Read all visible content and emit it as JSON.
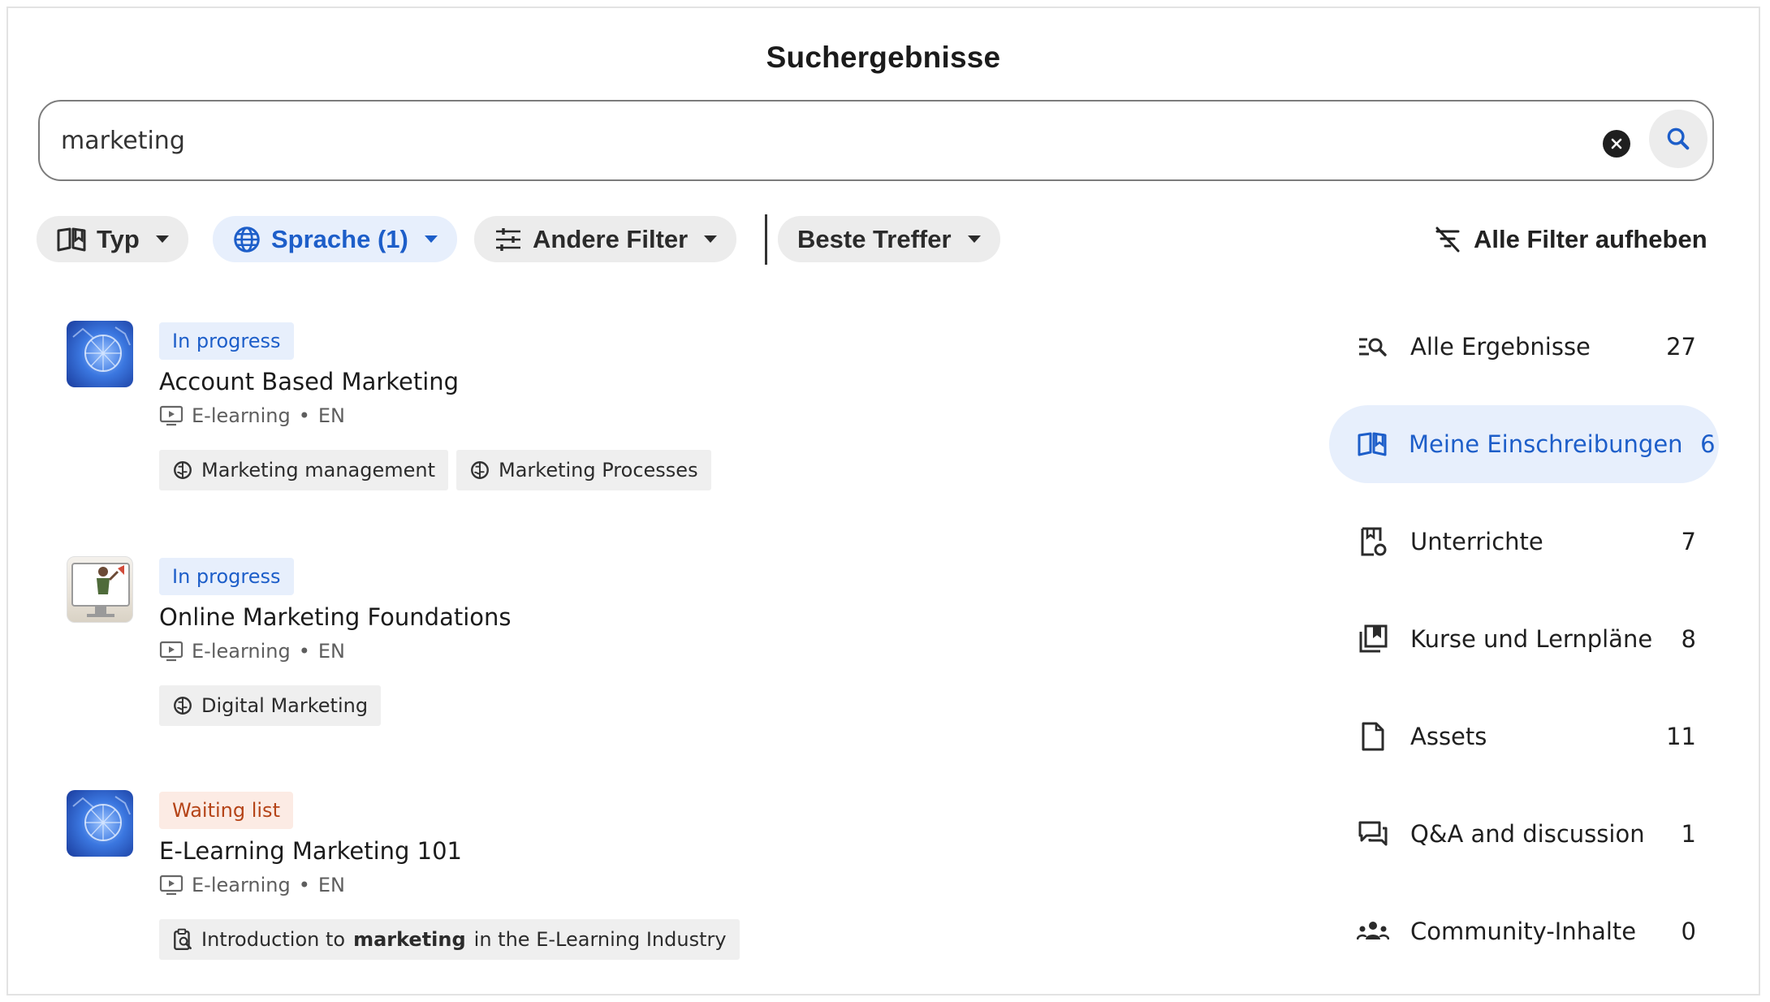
{
  "page": {
    "title": "Suchergebnisse"
  },
  "search": {
    "value": "marketing",
    "placeholder": ""
  },
  "filters": {
    "type_label": "Typ",
    "language_label": "Sprache (1)",
    "other_label": "Andere Filter",
    "sort_label": "Beste Treffer",
    "clear_all_label": "Alle Filter aufheben"
  },
  "results": [
    {
      "status": "In progress",
      "title": "Account Based Marketing",
      "type": "E-learning",
      "separator": "•",
      "lang": "EN",
      "tags": [
        "Marketing management",
        "Marketing Processes"
      ]
    },
    {
      "status": "In progress",
      "title": "Online Marketing Foundations",
      "type": "E-learning",
      "separator": "•",
      "lang": "EN",
      "tags": [
        "Digital Marketing"
      ]
    },
    {
      "status": "Waiting list",
      "title": "E-Learning Marketing 101",
      "type": "E-learning",
      "separator": "•",
      "lang": "EN",
      "tag_prefix": "Introduction to",
      "tag_highlight": "marketing",
      "tag_suffix": "in the E-Learning Industry"
    }
  ],
  "sidebar": {
    "items": [
      {
        "label": "Alle Ergebnisse",
        "count": "27",
        "icon": "search-list-icon"
      },
      {
        "label": "Meine Einschreibungen",
        "count": "6",
        "icon": "open-book-icon"
      },
      {
        "label": "Unterrichte",
        "count": "7",
        "icon": "lesson-icon"
      },
      {
        "label": "Kurse und Lernpläne",
        "count": "8",
        "icon": "courses-icon"
      },
      {
        "label": "Assets",
        "count": "11",
        "icon": "file-icon"
      },
      {
        "label": "Q&A and discussion",
        "count": "1",
        "icon": "discussion-icon"
      },
      {
        "label": "Community-Inhalte",
        "count": "0",
        "icon": "community-icon"
      }
    ]
  },
  "colors": {
    "accent": "#1d5ec9",
    "accent_bg": "#e7effc",
    "waiting": "#b54418",
    "waiting_bg": "#fcebe4"
  }
}
